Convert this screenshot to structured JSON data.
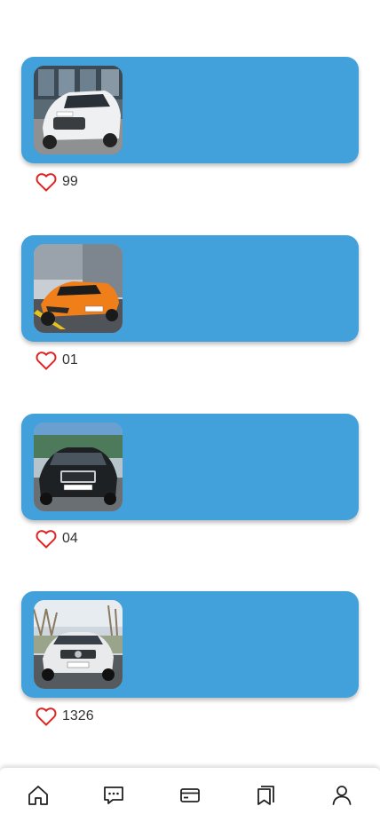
{
  "posts": [
    {
      "likes": "99",
      "photo": "white-sedan-photo",
      "car_color": "#eef0f2"
    },
    {
      "likes": "01",
      "photo": "orange-sports-car-photo",
      "car_color": "#f07f1a"
    },
    {
      "likes": "04",
      "photo": "black-sedan-photo",
      "car_color": "#1e2124"
    },
    {
      "likes": "1326",
      "photo": "white-mercedes-photo",
      "car_color": "#e8eaec"
    }
  ],
  "tabbar": {
    "tabs": [
      {
        "icon": "home-icon"
      },
      {
        "icon": "chat-icon"
      },
      {
        "icon": "card-icon"
      },
      {
        "icon": "bookmarks-icon"
      },
      {
        "icon": "profile-icon"
      }
    ]
  },
  "colors": {
    "card": "#42a0db",
    "heart": "#e02424",
    "background": "#ffffff"
  }
}
